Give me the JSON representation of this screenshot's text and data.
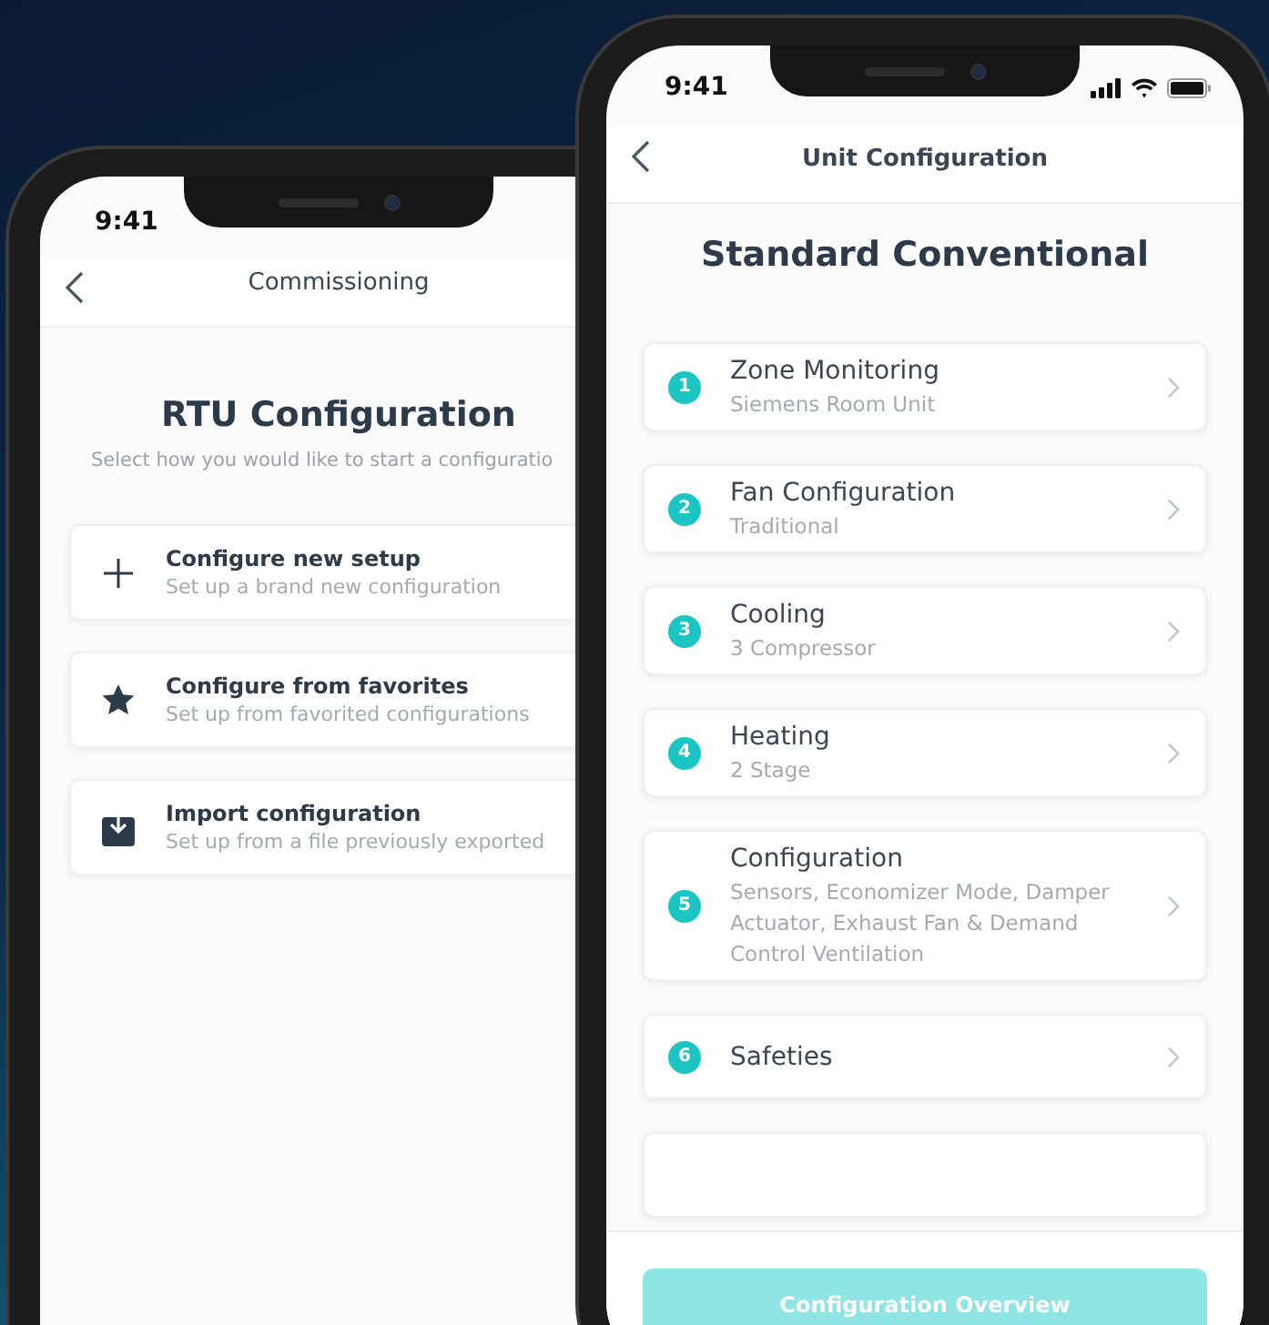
{
  "left_phone": {
    "status_bar": {
      "time": "9:41"
    },
    "header": {
      "title": "Commissioning"
    },
    "title": "RTU Configuration",
    "subtitle": "Select how you would like to start a configuratio",
    "options": [
      {
        "title": "Configure new setup",
        "subtitle": "Set up a brand new configuration"
      },
      {
        "title": "Configure from favorites",
        "subtitle": "Set up from favorited configurations"
      },
      {
        "title": "Import configuration",
        "subtitle": "Set up from a file previously exported"
      }
    ]
  },
  "right_phone": {
    "status_bar": {
      "time": "9:41"
    },
    "header": {
      "title": "Unit Configuration"
    },
    "title": "Standard Conventional",
    "steps": [
      {
        "number": "1",
        "title": "Zone Monitoring",
        "subtitle": "Siemens Room Unit"
      },
      {
        "number": "2",
        "title": "Fan Configuration",
        "subtitle": "Traditional"
      },
      {
        "number": "3",
        "title": "Cooling",
        "subtitle": "3 Compressor"
      },
      {
        "number": "4",
        "title": "Heating",
        "subtitle": "2 Stage"
      },
      {
        "number": "5",
        "title": "Configuration",
        "subtitle": "Sensors, Economizer Mode, Damper Actuator, Exhaust Fan & Demand Control Ventilation"
      },
      {
        "number": "6",
        "title": "Safeties"
      }
    ],
    "button": {
      "label": "Configuration Overview",
      "disabled": true
    }
  }
}
